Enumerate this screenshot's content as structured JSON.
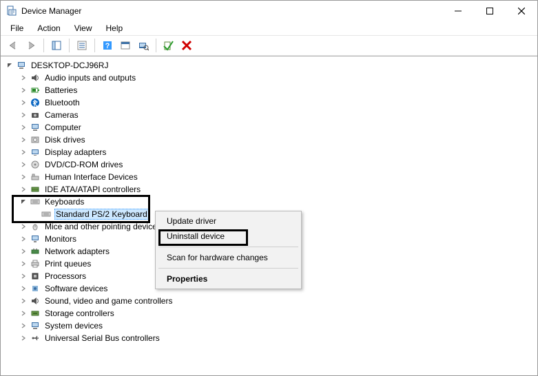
{
  "window": {
    "title": "Device Manager"
  },
  "menu": {
    "file": "File",
    "action": "Action",
    "view": "View",
    "help": "Help"
  },
  "tree": {
    "root": "DESKTOP-DCJ96RJ",
    "items": [
      "Audio inputs and outputs",
      "Batteries",
      "Bluetooth",
      "Cameras",
      "Computer",
      "Disk drives",
      "Display adapters",
      "DVD/CD-ROM drives",
      "Human Interface Devices",
      "IDE ATA/ATAPI controllers",
      "Keyboards",
      "Mice and other pointing devices",
      "Monitors",
      "Network adapters",
      "Print queues",
      "Processors",
      "Software devices",
      "Sound, video and game controllers",
      "Storage controllers",
      "System devices",
      "Universal Serial Bus controllers"
    ],
    "keyboard_child": "Standard PS/2 Keyboard"
  },
  "context_menu": {
    "update": "Update driver",
    "uninstall": "Uninstall device",
    "scan": "Scan for hardware changes",
    "properties": "Properties"
  }
}
